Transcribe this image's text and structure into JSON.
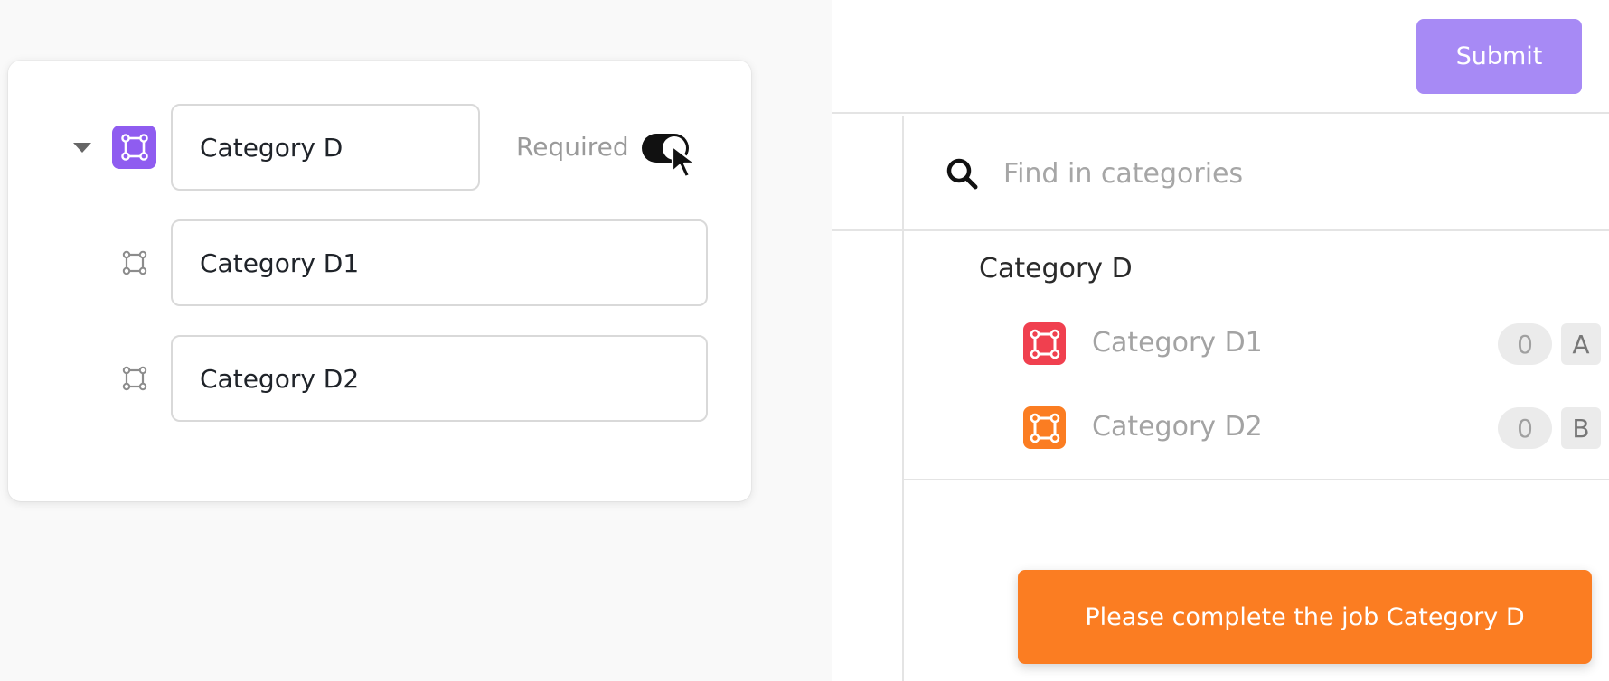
{
  "editor": {
    "parent": {
      "name": "Category D",
      "required_label": "Required",
      "required": true,
      "color": "#8f5cf0",
      "icon": "bounding-box-icon",
      "expand_icon": "caret-down-icon"
    },
    "children": [
      {
        "name": "Category D1",
        "icon": "bounding-box-icon"
      },
      {
        "name": "Category D2",
        "icon": "bounding-box-icon"
      }
    ]
  },
  "header": {
    "submit_label": "Submit",
    "submit_color": "#a78af5"
  },
  "search": {
    "placeholder": "Find in categories",
    "value": "",
    "icon": "search-icon"
  },
  "categories": {
    "group_title": "Category D",
    "items": [
      {
        "label": "Category D1",
        "count": "0",
        "hotkey": "A",
        "color": "#f0404f",
        "icon": "bounding-box-icon"
      },
      {
        "label": "Category D2",
        "count": "0",
        "hotkey": "B",
        "color": "#fb7d22",
        "icon": "bounding-box-icon"
      }
    ]
  },
  "toast": {
    "message": "Please complete the job Category D",
    "color": "#fb7d22"
  }
}
